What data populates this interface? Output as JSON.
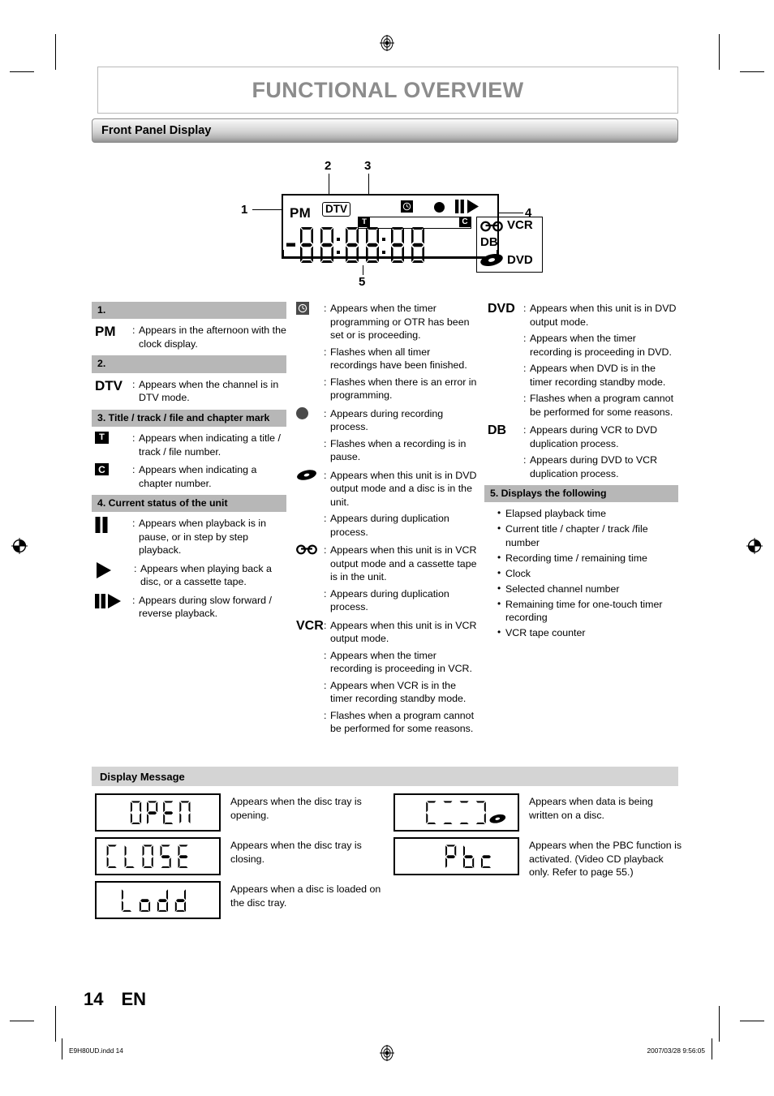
{
  "page": {
    "title": "FUNCTIONAL OVERVIEW",
    "number": "14",
    "lang": "EN",
    "footer_left": "E9H80UD.indd   14",
    "footer_right": "2007/03/28   9:56:05"
  },
  "sections": {
    "front_panel": "Front Panel Display",
    "display_message": "Display Message"
  },
  "lcd_diagram": {
    "callouts": {
      "one": "1",
      "two": "2",
      "three": "3",
      "four": "4",
      "five": "5"
    },
    "labels": {
      "pm": "PM",
      "dtv": "DTV",
      "title_mark": "T",
      "chapter_mark": "C",
      "vcr": "VCR",
      "db": "DB",
      "dvd": "DVD"
    },
    "icons": {
      "timer": "clock-icon",
      "record": "record-dot-icon",
      "pause": "pause-icon",
      "play": "play-icon",
      "cassette": "cassette-tape-icon",
      "disc": "disc-icon"
    },
    "segment_readout": "-00.00.00"
  },
  "legend": {
    "col1": [
      {
        "heading": "1.",
        "entries": [
          {
            "symbol": "PM",
            "symbol_kind": "text",
            "lines": [
              "Appears in the afternoon with the clock display."
            ]
          }
        ]
      },
      {
        "heading": "2.",
        "entries": [
          {
            "symbol": "DTV",
            "symbol_kind": "text",
            "lines": [
              "Appears when the channel is in DTV mode."
            ]
          }
        ]
      },
      {
        "heading": "3. Title / track / file and chapter mark",
        "entries": [
          {
            "symbol": "T",
            "symbol_kind": "boxed",
            "lines": [
              "Appears when indicating a title / track / file number."
            ]
          },
          {
            "symbol": "C",
            "symbol_kind": "boxed",
            "lines": [
              "Appears when indicating a chapter number."
            ]
          }
        ]
      },
      {
        "heading": "4. Current status of the unit",
        "entries": [
          {
            "symbol": "pause-icon",
            "symbol_kind": "icon",
            "lines": [
              "Appears when playback is in pause, or in step by step playback."
            ]
          },
          {
            "symbol": "play-icon",
            "symbol_kind": "icon",
            "lines": [
              "Appears when playing back a disc, or a cassette tape."
            ]
          },
          {
            "symbol": "slow-play-icon",
            "symbol_kind": "icon",
            "lines": [
              "Appears during slow forward / reverse playback."
            ]
          }
        ]
      }
    ],
    "col2": [
      {
        "symbol": "clock-icon",
        "symbol_kind": "icon",
        "lines": [
          "Appears when the timer programming or OTR has been set or is proceeding.",
          "Flashes when all timer recordings have been finished.",
          "Flashes when there is an error in programming."
        ]
      },
      {
        "symbol": "record-dot-icon",
        "symbol_kind": "icon",
        "lines": [
          "Appears during recording process.",
          "Flashes when a recording is in pause."
        ]
      },
      {
        "symbol": "disc-icon",
        "symbol_kind": "icon",
        "lines": [
          "Appears when this unit is in DVD output mode and a disc is in the unit.",
          "Appears during duplication process."
        ]
      },
      {
        "symbol": "cassette-tape-icon",
        "symbol_kind": "icon",
        "lines": [
          "Appears when this unit is in VCR output mode and a cassette tape is in the unit.",
          "Appears during duplication process."
        ]
      },
      {
        "symbol": "VCR",
        "symbol_kind": "text",
        "lines": [
          "Appears when this unit is in VCR output mode.",
          "Appears when the timer recording is proceeding in VCR.",
          "Appears when VCR is in the timer recording standby mode.",
          "Flashes when a program cannot be performed for some reasons."
        ]
      }
    ],
    "col3": {
      "entries": [
        {
          "symbol": "DVD",
          "symbol_kind": "text",
          "lines": [
            "Appears when this unit is in DVD output mode.",
            "Appears when the timer recording is proceeding in DVD.",
            "Appears when DVD is in the timer recording standby mode.",
            "Flashes when a program cannot be performed for some reasons."
          ]
        },
        {
          "symbol": "DB",
          "symbol_kind": "text",
          "lines": [
            "Appears during VCR to DVD duplication process.",
            "Appears during DVD to VCR duplication process."
          ]
        }
      ],
      "heading5": "5. Displays the following",
      "bullets": [
        "Elapsed playback time",
        "Current title / chapter / track /file number",
        "Recording time / remaining time",
        "Clock",
        "Selected channel number",
        "Remaining time for one-touch timer recording",
        "VCR tape counter"
      ]
    }
  },
  "display_messages": {
    "left": [
      {
        "readout": "OPEN",
        "text": "Appears when the disc tray is opening."
      },
      {
        "readout": "CLOSE",
        "text": "Appears when the disc tray is closing."
      },
      {
        "readout": "Load",
        "text": "Appears when a disc is loaded on the disc tray."
      }
    ],
    "right": [
      {
        "readout": "C---o",
        "text": "Appears when data is being written on a disc."
      },
      {
        "readout": "Pbc",
        "text": "Appears when the PBC function is activated. (Video CD playback only. Refer to page 55.)"
      }
    ]
  },
  "colors": {
    "title_gray": "#8c8c8c",
    "subbar_gray": "#b7b7b7",
    "dmbar_gray": "#d4d4d4"
  }
}
